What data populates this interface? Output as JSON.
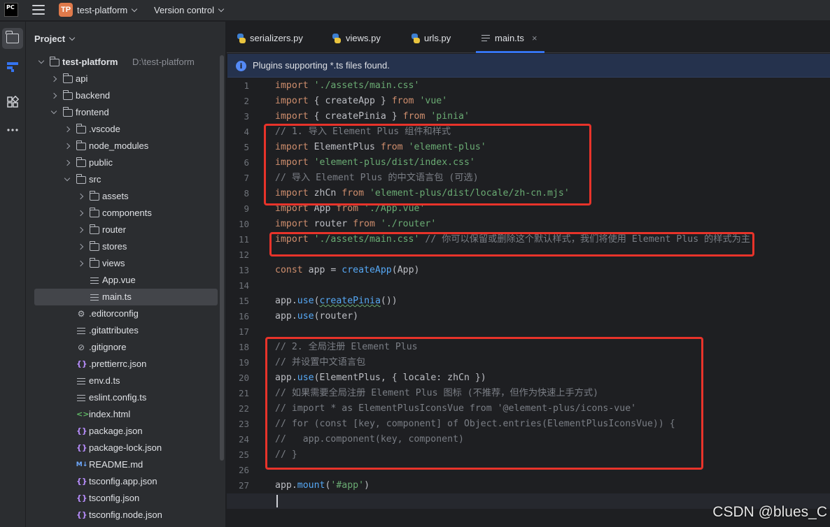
{
  "titlebar": {
    "app_logo_text": "PC",
    "project_badge": "TP",
    "project_name": "test-platform",
    "version_control": "Version control"
  },
  "toolstrip": {
    "items": [
      "project-icon",
      "structure-icon",
      "plugins-icon",
      "more-icon"
    ]
  },
  "project_panel": {
    "title": "Project",
    "root": {
      "name": "test-platform",
      "path": "D:\\test-platform"
    },
    "items": [
      {
        "label": "api"
      },
      {
        "label": "backend"
      },
      {
        "label": "frontend"
      },
      {
        "label": ".vscode"
      },
      {
        "label": "node_modules"
      },
      {
        "label": "public"
      },
      {
        "label": "src"
      },
      {
        "label": "assets"
      },
      {
        "label": "components"
      },
      {
        "label": "router"
      },
      {
        "label": "stores"
      },
      {
        "label": "views"
      },
      {
        "label": "App.vue"
      },
      {
        "label": "main.ts"
      },
      {
        "label": ".editorconfig"
      },
      {
        "label": ".gitattributes"
      },
      {
        "label": ".gitignore"
      },
      {
        "label": ".prettierrc.json"
      },
      {
        "label": "env.d.ts"
      },
      {
        "label": "eslint.config.ts"
      },
      {
        "label": "index.html"
      },
      {
        "label": "package.json"
      },
      {
        "label": "package-lock.json"
      },
      {
        "label": "README.md"
      },
      {
        "label": "tsconfig.app.json"
      },
      {
        "label": "tsconfig.json"
      },
      {
        "label": "tsconfig.node.json"
      }
    ]
  },
  "editor": {
    "tabs": [
      {
        "label": "serializers.py"
      },
      {
        "label": "views.py"
      },
      {
        "label": "urls.py"
      },
      {
        "label": "main.ts",
        "close": "×"
      }
    ],
    "banner": "Plugins supporting *.ts files found.",
    "current_line": 28,
    "code": {
      "l1": [
        "import",
        " './assets/main.css'"
      ],
      "l2": [
        "import",
        " { createApp } ",
        "from",
        " 'vue'"
      ],
      "l3": [
        "import",
        " { createPinia } ",
        "from",
        " 'pinia'"
      ],
      "l4": "// 1. 导入 Element Plus 组件和样式",
      "l5": [
        "import",
        " ElementPlus ",
        "from",
        " 'element-plus'"
      ],
      "l6": [
        "import",
        " 'element-plus/dist/index.css'"
      ],
      "l7": "// 导入 Element Plus 的中文语言包 (可选)",
      "l8": [
        "import",
        " zhCn ",
        "from",
        " 'element-plus/dist/locale/zh-cn.mjs'"
      ],
      "l9": [
        "import",
        " App ",
        "from",
        " './App.vue'"
      ],
      "l10": [
        "import",
        " router ",
        "from",
        " './router'"
      ],
      "l11": [
        "import",
        " './assets/main.css'",
        " // 你可以保留或删除这个默认样式，我们将使用 Element Plus 的样式为主"
      ],
      "l13": [
        "const",
        " app = ",
        "createApp",
        "(App)"
      ],
      "l15": [
        "app.",
        "use",
        "(",
        "createPinia",
        "())"
      ],
      "l16": [
        "app.",
        "use",
        "(router)"
      ],
      "l18": "// 2. 全局注册 Element Plus",
      "l19": "// 并设置中文语言包",
      "l20": [
        "app.",
        "use",
        "(ElementPlus, { locale: zhCn })"
      ],
      "l21": "// 如果需要全局注册 Element Plus 图标 (不推荐，但作为快速上手方式)",
      "l22": "// import * as ElementPlusIconsVue from '@element-plus/icons-vue'",
      "l23": "// for (const [key, component] of Object.entries(ElementPlusIconsVue)) {",
      "l24": "//   app.component(key, component)",
      "l25": "// }",
      "l27": [
        "app.",
        "mount",
        "(",
        "'#app'",
        ")"
      ]
    }
  },
  "watermark": "CSDN @blues_C",
  "colors": {
    "keyword": "#cf8e6d",
    "string": "#6aab73",
    "comment": "#7a7e85",
    "function": "#56a8f5",
    "highlight_box": "#e8332a",
    "accent": "#3574f0"
  }
}
